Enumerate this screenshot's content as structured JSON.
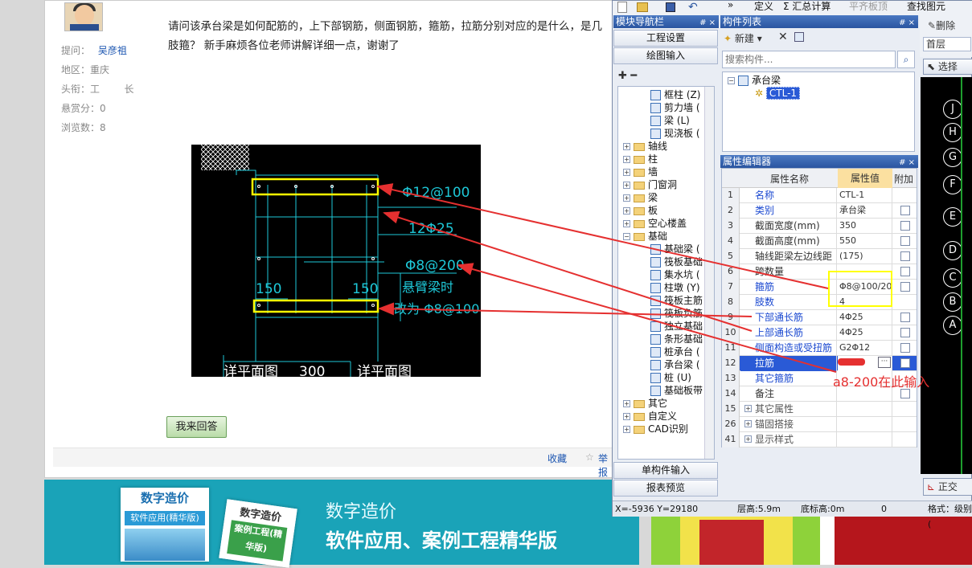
{
  "forum": {
    "asker_label": "提问：",
    "asker_name": "吴彦祖",
    "region": "地区：重庆",
    "title": "头衔：工        长",
    "bounty": "悬赏分：0",
    "views": "浏览数：8",
    "question": "请问该承台梁是如何配筋的，上下部钢筋，侧面钢筋，箍筋，拉筋分别对应的是什么，是几肢箍？ 新手麻烦各位老师讲解详细一点，谢谢了",
    "reply_button": "我来回答",
    "collect_link": "收藏",
    "report_link": "举报"
  },
  "cad_drawing": {
    "labels": [
      "Φ12@100",
      "12Φ25",
      "Φ8@200",
      "悬臂梁时",
      "改为 Φ8@100",
      "150",
      "150",
      "详平面图",
      "300",
      "详平面图"
    ]
  },
  "banner": {
    "title": "数字造价",
    "subtitle": "软件应用、案例工程精华版",
    "book1_title": "数字造价",
    "book1_sub": "软件应用(精华版)",
    "book2_title": "数字造价",
    "book2_sub": "案例工程(精华版)"
  },
  "app": {
    "toolbar": {
      "define": "定义",
      "sum_calc": "Σ 汇总计算",
      "flat_top": "平齐板顶",
      "find_element": "查找图元"
    },
    "nav_panel": {
      "title": "模块导航栏",
      "pin": "# ×",
      "buttons": [
        "工程设置",
        "绘图输入"
      ],
      "bottom_buttons": [
        "单构件输入",
        "报表预览"
      ],
      "tree_top": [
        "框柱 (Z)",
        "剪力墙 (",
        "梁 (L)",
        "现浇板 ("
      ],
      "folders": [
        "轴线",
        "柱",
        "墙",
        "门窗洞",
        "梁",
        "板",
        "空心楼盖"
      ],
      "foundation_folder": "基础",
      "foundation_items": [
        "基础梁 (",
        "筏板基础",
        "集水坑 (",
        "柱墩 (Y)",
        "筏板主筋",
        "筏板负筋",
        "独立基础",
        "条形基础",
        "桩承台 (",
        "承台梁 (",
        "桩 (U)",
        "基础板带"
      ],
      "folders_after": [
        "其它",
        "自定义",
        "CAD识别"
      ]
    },
    "component_list": {
      "title": "构件列表",
      "pin": "# ×",
      "new_button": "新建",
      "search_placeholder": "搜索构件...",
      "root": "承台梁",
      "child": "CTL-1"
    },
    "property_editor": {
      "title": "属性编辑器",
      "pin": "# ×",
      "headers": [
        "属性名称",
        "属性值",
        "附加"
      ],
      "rows": [
        {
          "n": "1",
          "k": "名称",
          "v": "CTL-1",
          "blue": true,
          "check": false
        },
        {
          "n": "2",
          "k": "类别",
          "v": "承台梁",
          "blue": true,
          "check": true
        },
        {
          "n": "3",
          "k": "截面宽度(mm)",
          "v": "350",
          "blue": false,
          "check": true
        },
        {
          "n": "4",
          "k": "截面高度(mm)",
          "v": "550",
          "blue": false,
          "check": true
        },
        {
          "n": "5",
          "k": "轴线距梁左边线距",
          "v": "(175)",
          "blue": false,
          "check": true
        },
        {
          "n": "6",
          "k": "跨数量",
          "v": "",
          "blue": false,
          "check": true
        },
        {
          "n": "7",
          "k": "箍筋",
          "v": "Φ8@100/20",
          "blue": true,
          "check": true
        },
        {
          "n": "8",
          "k": "肢数",
          "v": "4",
          "blue": true,
          "check": false
        },
        {
          "n": "9",
          "k": "下部通长筋",
          "v": "4Φ25",
          "blue": true,
          "check": true
        },
        {
          "n": "10",
          "k": "上部通长筋",
          "v": "4Φ25",
          "blue": true,
          "check": true
        },
        {
          "n": "11",
          "k": "侧面构造或受扭筋",
          "v": "G2Φ12",
          "blue": true,
          "check": true
        },
        {
          "n": "12",
          "k": "拉筋",
          "v": "",
          "blue": true,
          "check": true
        },
        {
          "n": "13",
          "k": "其它箍筋",
          "v": "",
          "blue": true,
          "check": false
        },
        {
          "n": "14",
          "k": "备注",
          "v": "",
          "blue": false,
          "check": true
        },
        {
          "n": "15",
          "k": "其它属性",
          "v": "",
          "blue": false,
          "check": false
        },
        {
          "n": "26",
          "k": "锚固搭接",
          "v": "",
          "blue": false,
          "check": false
        },
        {
          "n": "41",
          "k": "显示样式",
          "v": "",
          "blue": false,
          "check": false
        }
      ]
    },
    "annotation": "a8-200在此输入",
    "right_panel": {
      "delete_button": "删除",
      "floor": "首层",
      "select_button": "选择",
      "axis_labels": [
        "J",
        "H",
        "G",
        "F",
        "E",
        "D",
        "C",
        "B",
        "A"
      ],
      "ortho_button": "正交",
      "format_label": "格式：级别("
    },
    "status_bar": {
      "coords": "X=-5936 Y=29180",
      "floor_height": "层高:5.9m",
      "base_height": "底标高:0m",
      "value": "0"
    }
  },
  "colors": {
    "highlight_yellow": "#ffff00",
    "arrow_red": "#e53030",
    "title_blue": "#2a55a0",
    "banner_teal": "#1aa3b8"
  }
}
